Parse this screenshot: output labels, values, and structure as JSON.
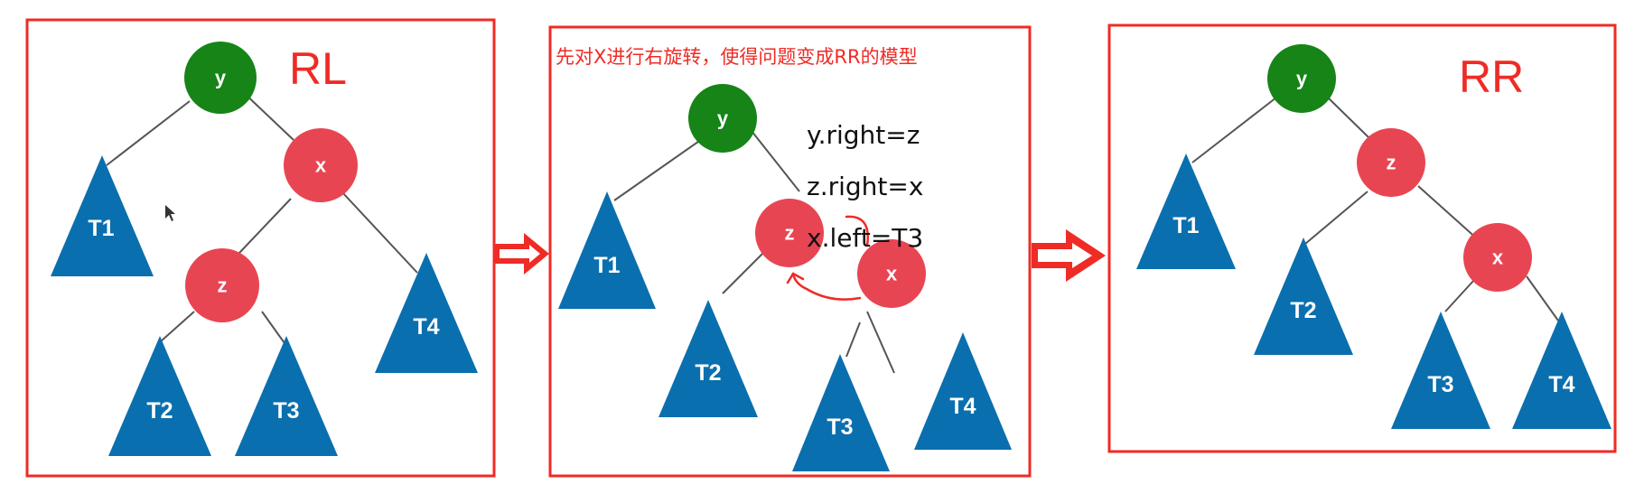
{
  "colors": {
    "frame": "#ef2b25",
    "root_node": "#168417",
    "child_node": "#e84552",
    "subtree": "#0a6fae",
    "edge": "#555555",
    "arrow": "#ef2b25"
  },
  "panels": [
    {
      "case_label": "RL",
      "caption": "",
      "notes": [],
      "nodes": {
        "y": "y",
        "x": "x",
        "z": "z"
      },
      "subtrees": {
        "t1": "T1",
        "t2": "T2",
        "t3": "T3",
        "t4": "T4"
      }
    },
    {
      "case_label": "",
      "caption": "先对X进行右旋转，使得问题变成RR的模型",
      "notes": [
        "y.right=z",
        "z.right=x",
        "x.left=T3"
      ],
      "nodes": {
        "y": "y",
        "z": "z",
        "x": "x"
      },
      "subtrees": {
        "t1": "T1",
        "t2": "T2",
        "t3": "T3",
        "t4": "T4"
      }
    },
    {
      "case_label": "RR",
      "caption": "",
      "notes": [],
      "nodes": {
        "y": "y",
        "z": "z",
        "x": "x"
      },
      "subtrees": {
        "t1": "T1",
        "t2": "T2",
        "t3": "T3",
        "t4": "T4"
      }
    }
  ],
  "icons": [
    "transition-arrow-icon",
    "rotation-curved-arrow-icon",
    "mouse-cursor-icon"
  ]
}
